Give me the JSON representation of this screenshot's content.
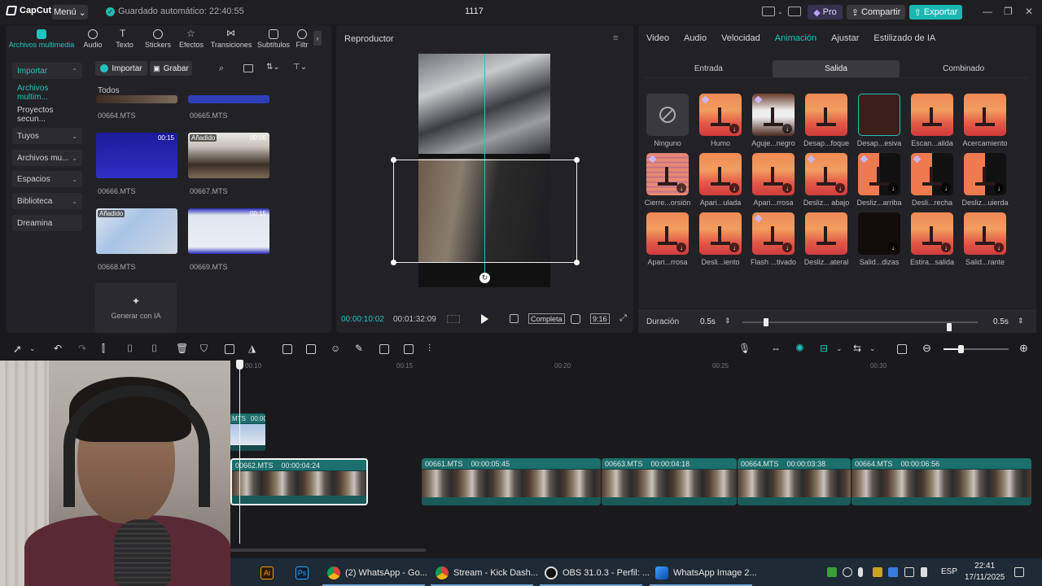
{
  "app": {
    "logo": "CapCut",
    "menu_label": "Menú",
    "autosave": "Guardado automático: 22:40:55",
    "project_title": "1117",
    "pro_label": "Pro",
    "share_label": "Compartir",
    "export_label": "Exportar"
  },
  "media": {
    "tabs": [
      {
        "label": "Archivos multimedia"
      },
      {
        "label": "Audio"
      },
      {
        "label": "Texto"
      },
      {
        "label": "Stickers"
      },
      {
        "label": "Efectos"
      },
      {
        "label": "Transiciones"
      },
      {
        "label": "Subtítulos"
      },
      {
        "label": "Filtr"
      }
    ],
    "sidebar": [
      {
        "label": "Importar"
      },
      {
        "label": "Archivos multim..."
      },
      {
        "label": "Proyectos secun..."
      },
      {
        "label": "Tuyos"
      },
      {
        "label": "Archivos mu..."
      },
      {
        "label": "Espacios"
      },
      {
        "label": "Biblioteca"
      },
      {
        "label": "Dreamina"
      }
    ],
    "import_btn": "Importar",
    "record_btn": "Grabar",
    "filter_all": "Todos",
    "items": [
      {
        "name": "00664.MTS",
        "duration": "",
        "badge": ""
      },
      {
        "name": "00665.MTS",
        "duration": "",
        "badge": ""
      },
      {
        "name": "00666.MTS",
        "duration": "00:15",
        "badge": ""
      },
      {
        "name": "00667.MTS",
        "duration": "00:06",
        "badge": "Añadido"
      },
      {
        "name": "00668.MTS",
        "duration": "",
        "badge": "Añadido"
      },
      {
        "name": "00669.MTS",
        "duration": "00:15",
        "badge": ""
      }
    ],
    "generate_ia": "Generar con IA"
  },
  "player": {
    "title": "Reproductor",
    "current_time": "00:00:10:02",
    "total_time": "00:01:32:09",
    "full_label": "Completa",
    "ratio_label": "9:16"
  },
  "right_panel": {
    "tabs": [
      "Video",
      "Audio",
      "Velocidad",
      "Animación",
      "Ajustar",
      "Estilizado de IA"
    ],
    "subtabs": [
      "Entrada",
      "Salida",
      "Combinado"
    ],
    "animations": [
      "Ninguno",
      "Humo",
      "Aguje...negro",
      "Desap...foque",
      "Desap...esiva",
      "Escan...alida",
      "Acercamiento",
      "Cierre...orsión",
      "Apari...ulada",
      "Apari...rrosa",
      "Desliz... abajo",
      "Desliz...arriba",
      "Desli...recha",
      "Desliz...uierda",
      "Apari...rrosa",
      "Desli...iento",
      "Flash ...tivado",
      "Desliz...ateral",
      "Salid...dizas",
      "Estira...salida",
      "Salid...rante"
    ],
    "duration_label": "Duración",
    "duration_in": "0.5s",
    "duration_out": "0.5s",
    "duration_in_fraction": 0.1,
    "duration_out_fraction": 0.88
  },
  "timeline": {
    "ruler": [
      "00:10",
      "00:15",
      "00:20",
      "00:25",
      "00:30"
    ],
    "small_clip": {
      "name": "MTS",
      "time": "00:00"
    },
    "clips": [
      {
        "name": "00662.MTS",
        "duration": "00:00:04:24"
      },
      {
        "name": "00661.MTS",
        "duration": "00:00:05:45"
      },
      {
        "name": "00663.MTS",
        "duration": "00:00:04:18"
      },
      {
        "name": "00664.MTS",
        "duration": "00:00:03:38"
      },
      {
        "name": "00664.MTS",
        "duration": "00:00:06:56"
      }
    ]
  },
  "taskbar": {
    "apps": [
      {
        "label": "(2) WhatsApp - Go..."
      },
      {
        "label": "Stream - Kick Dash..."
      },
      {
        "label": "OBS 31.0.3 - Perfil: ..."
      },
      {
        "label": "WhatsApp Image 2..."
      }
    ],
    "lang": "ESP",
    "time": "22:41",
    "date": "17/11/2025"
  }
}
